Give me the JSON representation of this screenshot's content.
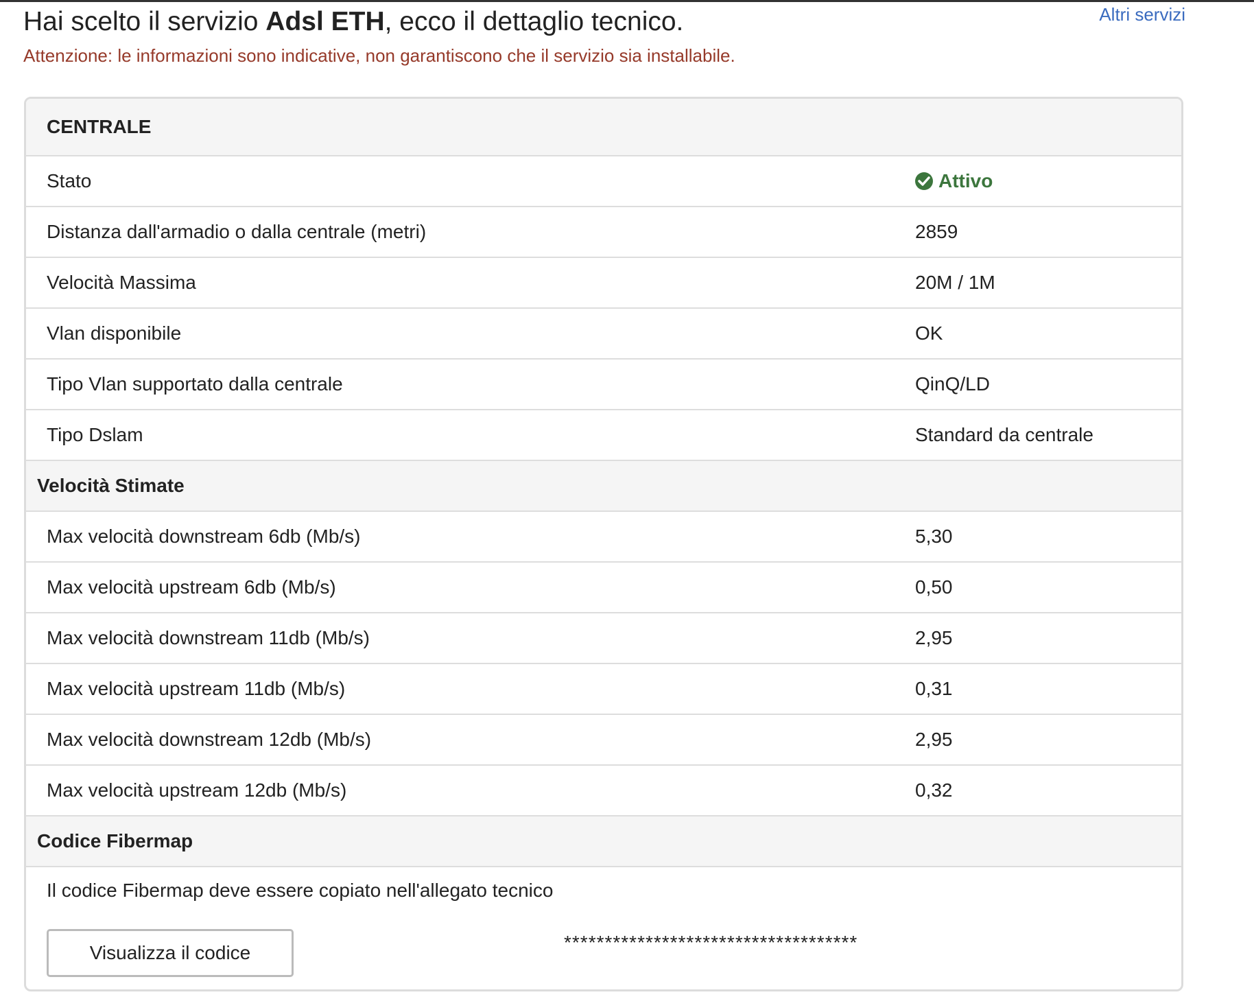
{
  "header": {
    "title_prefix": "Hai scelto il servizio ",
    "service_name": "Adsl ETH",
    "title_suffix": ", ecco il dettaglio tecnico.",
    "other_services_link": "Altri servizi",
    "warning": "Attenzione: le informazioni sono indicative, non garantiscono che il servizio sia installabile."
  },
  "panel": {
    "title": "CENTRALE",
    "rows": [
      {
        "label": "Stato",
        "value": "Attivo",
        "status": "active"
      },
      {
        "label": "Distanza dall'armadio o dalla centrale (metri)",
        "value": "2859"
      },
      {
        "label": "Velocità Massima",
        "value": "20M / 1M"
      },
      {
        "label": "Vlan disponibile",
        "value": "OK"
      },
      {
        "label": "Tipo Vlan supportato dalla centrale",
        "value": "QinQ/LD"
      },
      {
        "label": "Tipo Dslam",
        "value": "Standard da centrale"
      }
    ],
    "speed_section": {
      "title": "Velocità Stimate",
      "rows": [
        {
          "label": "Max velocità downstream 6db (Mb/s)",
          "value": "5,30"
        },
        {
          "label": "Max velocità upstream 6db (Mb/s)",
          "value": "0,50"
        },
        {
          "label": "Max velocità downstream 11db (Mb/s)",
          "value": "2,95"
        },
        {
          "label": "Max velocità upstream 11db (Mb/s)",
          "value": "0,31"
        },
        {
          "label": "Max velocità downstream 12db (Mb/s)",
          "value": "2,95"
        },
        {
          "label": "Max velocità upstream 12db (Mb/s)",
          "value": "0,32"
        }
      ]
    },
    "fibermap_section": {
      "title": "Codice Fibermap",
      "note": "Il codice Fibermap deve essere copiato nell'allegato tecnico",
      "button_label": "Visualizza il codice",
      "masked_code": "************************************"
    }
  },
  "colors": {
    "status_active": "#3c763d",
    "warning_text": "#963a2a",
    "link": "#3a6bbf"
  },
  "icons": {
    "status": "check-circle-icon"
  }
}
